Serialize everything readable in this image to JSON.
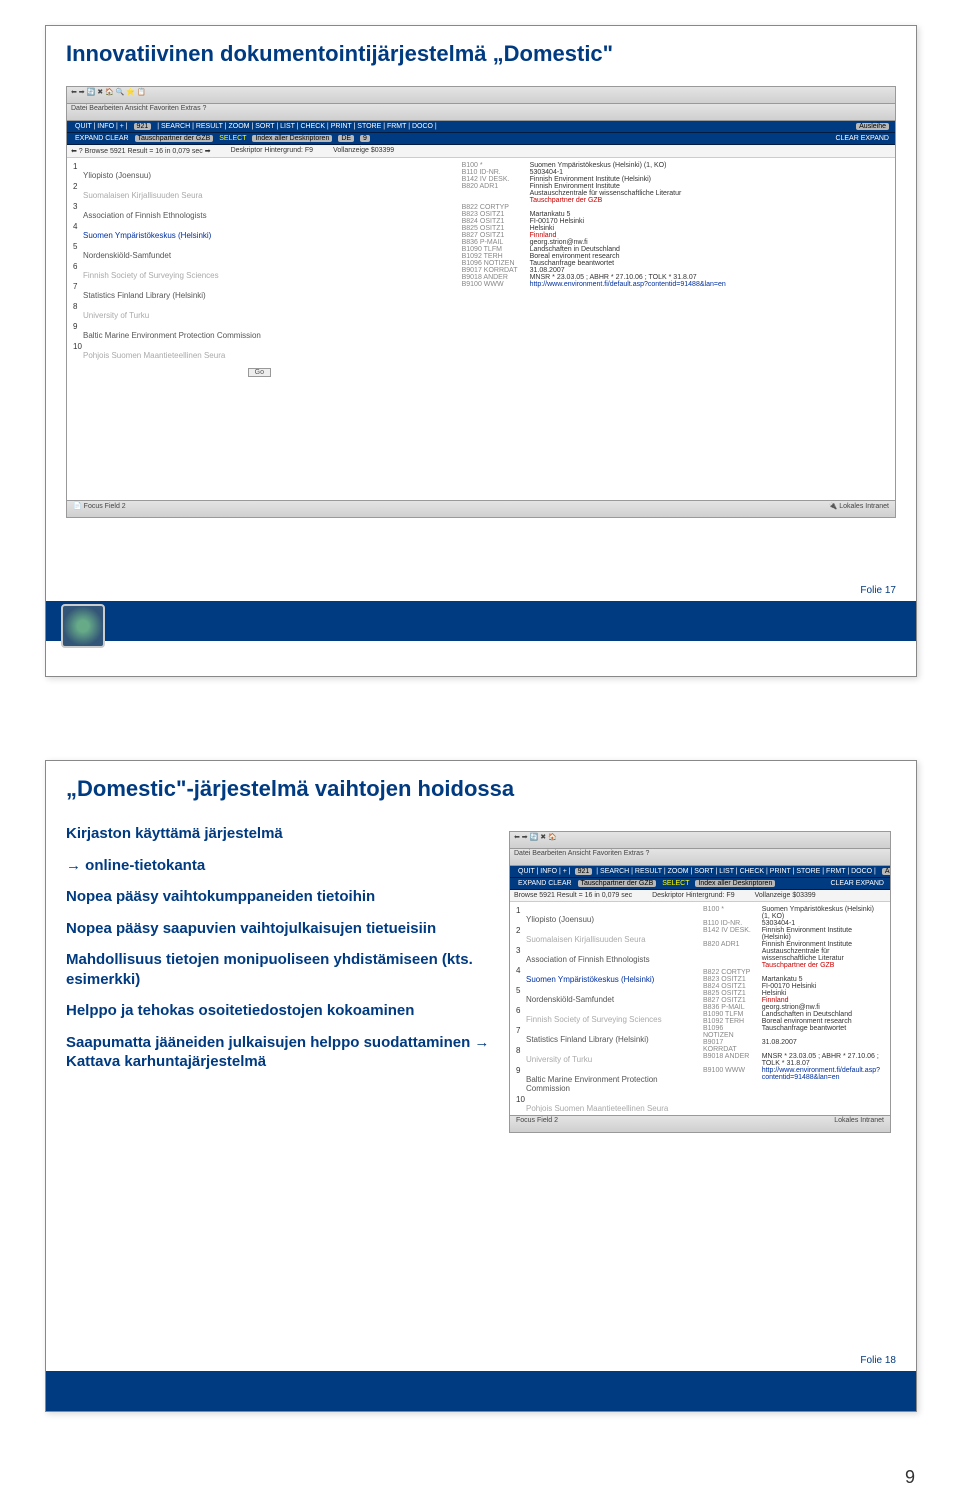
{
  "page_number": "9",
  "slide1": {
    "title": "Innovatiivinen dokumentointijärjestelmä „Domestic\"",
    "folie": "Folie 17",
    "app": {
      "menu": "Datei   Bearbeiten   Ansicht   Favoriten   Extras   ?",
      "cmd1_left": "QUIT | INFO | + |",
      "cmd1_mid": "| SEARCH | RESULT | ZOOM | SORT | LIST | CHECK | PRINT | STORE | FRMT | DOCO |",
      "cmd1_box": "921",
      "cmd1_right": "Ausleihe",
      "cmd2_left": "EXPAND  CLEAR",
      "cmd2_mid1": "Tauschpartner der GZB",
      "cmd2_sel": "SELECT",
      "cmd2_mid2": "Index aller Deskriptoren",
      "cmd2_de": "DE",
      "cmd2_n": "9",
      "cmd2_right": "CLEAR  EXPAND",
      "browse": "Browse 5921 Result = 16 in 0,079 sec",
      "desk": "Deskriptor Hintergrund: F9",
      "voll": "Vollanzeige $03399",
      "left_items": [
        {
          "n": "1",
          "t": "Yliopisto (Joensuu)",
          "cls": ""
        },
        {
          "n": "2",
          "t": "Suomalaisen Kirjallisuuden Seura",
          "cls": "dim"
        },
        {
          "n": "3",
          "t": "Association of Finnish Ethnologists",
          "cls": ""
        },
        {
          "n": "4",
          "t": "Suomen Ympäristökeskus (Helsinki)",
          "cls": "on"
        },
        {
          "n": "5",
          "t": "Nordenskiöld-Samfundet",
          "cls": ""
        },
        {
          "n": "6",
          "t": "Finnish Society of Surveying Sciences",
          "cls": "dim"
        },
        {
          "n": "7",
          "t": "Statistics Finland Library (Helsinki)",
          "cls": ""
        },
        {
          "n": "8",
          "t": "University of Turku",
          "cls": "dim"
        },
        {
          "n": "9",
          "t": "Baltic Marine Environment Protection Commission",
          "cls": ""
        },
        {
          "n": "10",
          "t": "Pohjois Suomen Maantieteellinen Seura",
          "cls": "dim"
        }
      ],
      "go": "Go",
      "details": [
        [
          "B100 *",
          "Suomen Ympäristökeskus (Helsinki) (1, KO)"
        ],
        [
          "B110 ID-NR.",
          "5303404-1"
        ],
        [
          "B142 IV DESK.",
          "Finnish Environment Institute (Helsinki)"
        ],
        [
          "B820 ADR1",
          "Finnish Environment Institute"
        ],
        [
          "",
          "Austauschzentrale für wissenschaftliche Literatur"
        ],
        [
          "",
          "Tauschpartner der GZB",
          "red"
        ],
        [
          "B822 CORTYP",
          ""
        ],
        [
          "B823 OSITZ1",
          "Martankatu 5"
        ],
        [
          "B824 OSITZ1",
          "FI-00170 Helsinki"
        ],
        [
          "B825 OSITZ1",
          "Helsinki"
        ],
        [
          "B827 OSITZ1",
          "Finnland",
          "red"
        ],
        [
          "B836 P-MAIL",
          "georg.strion@nw.fi"
        ],
        [
          "B1090 TLFM",
          "Landschaften in Deutschland"
        ],
        [
          "B1092 TERH",
          "Boreal environment research"
        ],
        [
          "B1096 NOTIZEN",
          "Tauschanfrage beantwortet"
        ],
        [
          "B9017 KORRDAT",
          "31.08.2007"
        ],
        [
          "B9018 ANDER",
          "MNSR * 23.03.05 ; ABHR * 27.10.06 ; TOLK * 31.8.07"
        ],
        [
          "B9100 WWW",
          "http://www.environment.fi/default.asp?contentid=91488&lan=en",
          "blu"
        ]
      ],
      "status_left": "Focus Field 2",
      "status_right": "Lokales Intranet"
    }
  },
  "slide2": {
    "title": "„Domestic\"-järjestelmä vaihtojen hoidossa",
    "folie": "Folie 18",
    "bullets": [
      {
        "text": "Kirjaston käyttämä järjestelmä",
        "arrow": false
      },
      {
        "text": "online-tietokanta",
        "arrow": true
      },
      {
        "text": "Nopea pääsy vaihtokumppaneiden tietoihin",
        "arrow": false
      },
      {
        "text": "Nopea pääsy saapuvien vaihtojulkaisujen tietueisiin",
        "arrow": false
      },
      {
        "text": "Mahdollisuus tietojen monipuoliseen yhdistämiseen (kts. esimerkki)",
        "arrow": false
      },
      {
        "text": "Helppo ja tehokas osoitetiedostojen kokoaminen",
        "arrow": false
      },
      {
        "text": "Saapumatta jääneiden julkaisujen helppo suodattaminen → Kattava karhuntajärjestelmä",
        "arrow": false
      }
    ]
  }
}
